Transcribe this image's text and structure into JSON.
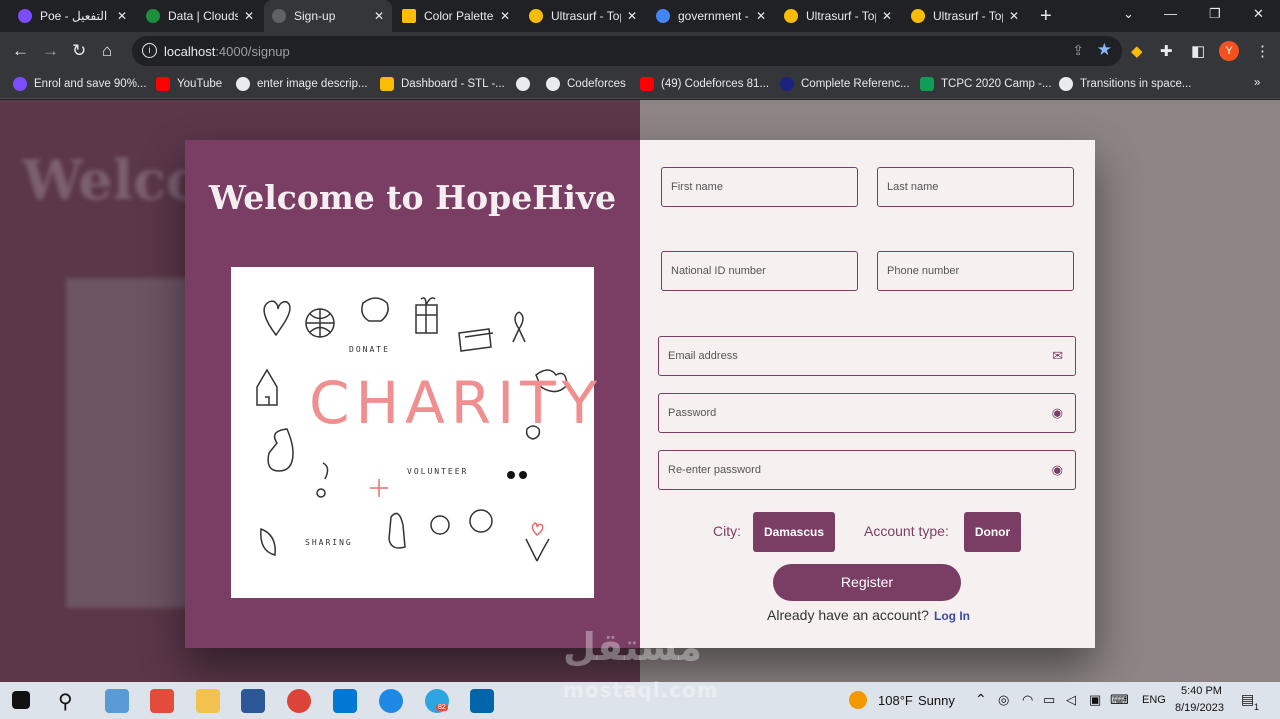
{
  "browser": {
    "tabs": [
      {
        "title": "Poe - التفعيل",
        "color": "#7c4dff"
      },
      {
        "title": "Data | Clouds",
        "color": "#1e8e3e"
      },
      {
        "title": "Sign-up",
        "color": "#5f6368"
      },
      {
        "title": "Color Palettes",
        "color": "#fbbc04"
      },
      {
        "title": "Ultrasurf - Top",
        "color": "#fbbc04"
      },
      {
        "title": "government -",
        "color": "#4285f4"
      },
      {
        "title": "Ultrasurf - Top",
        "color": "#fbbc04"
      },
      {
        "title": "Ultrasurf - Top",
        "color": "#fbbc04"
      }
    ],
    "url_host": "localhost",
    "url_path": ":4000/signup",
    "profile_initial": "Y",
    "bookmarks": [
      {
        "label": "Enrol and save 90%...",
        "color": "#7c4dff"
      },
      {
        "label": "YouTube",
        "color": "#ff0000"
      },
      {
        "label": "enter image descrip...",
        "color": "#e8eaed"
      },
      {
        "label": "Dashboard - STL -...",
        "color": "#fbbc04"
      },
      {
        "label": "",
        "color": "#e8eaed"
      },
      {
        "label": "Codeforces",
        "color": "#e8eaed"
      },
      {
        "label": "(49) Codeforces 81...",
        "color": "#ff0000"
      },
      {
        "label": "Complete Referenc...",
        "color": "#1a237e"
      },
      {
        "label": "TCPC 2020 Camp -...",
        "color": "#0f9d58"
      },
      {
        "label": "Transitions in space...",
        "color": "#e8eaed"
      }
    ]
  },
  "page": {
    "bg_welcome": "Welco",
    "title": "Welcome to HopeHive",
    "illustration": {
      "headline": "CHARITY",
      "words": [
        "DONATE",
        "VOLUNTEER",
        "SHARING"
      ]
    },
    "form": {
      "first_name": "First name",
      "last_name": "Last name",
      "national_id": "National ID number",
      "phone": "Phone number",
      "email": "Email address",
      "password": "Password",
      "reenter_password": "Re-enter password",
      "city_label": "City:",
      "city_value": "Damascus",
      "account_type_label": "Account type:",
      "account_type_value": "Donor",
      "register": "Register",
      "already": "Already have an account?",
      "login": "Log In"
    },
    "accent_color": "#7a3e65"
  },
  "taskbar": {
    "temperature": "108°F",
    "weather": "Sunny",
    "language": "ENG",
    "time": "5:40 PM",
    "date": "8/19/2023",
    "telegram_badge": "82",
    "notifications": "1"
  },
  "watermark": {
    "arabic": "مستقل",
    "latin": "mostaql.com"
  }
}
